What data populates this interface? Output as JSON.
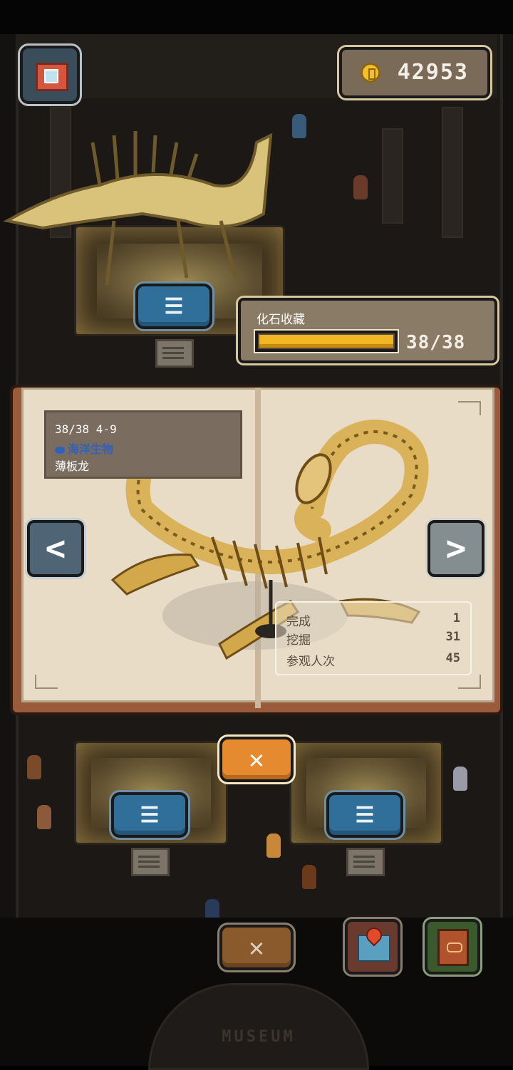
{
  "hud": {
    "coins": "42953",
    "coin_icon": "gold-coin-icon",
    "camera_icon": "camera-icon"
  },
  "collection": {
    "title": "化石收藏",
    "count": "38/38",
    "progress": 1.0
  },
  "fossil": {
    "entry": "38/38 4-9",
    "category": "海洋生物",
    "category_color": "#2f62b8",
    "name": "薄板龙",
    "stats": [
      {
        "label": "完成",
        "value": "1"
      },
      {
        "label": "挖掘",
        "value": "31"
      },
      {
        "label": "参观人次",
        "value": "45"
      }
    ]
  },
  "buttons": {
    "prev_symbol": "<",
    "next_symbol": ">",
    "close_symbol": "✕",
    "list_symbol": "☰"
  },
  "scene": {
    "entrance_sign": "MUSEUM"
  },
  "colors": {
    "book_cover": "#9a5a3c",
    "page": "#e8dcc6",
    "gold_bar": "#f2b524",
    "close_orange": "#e58a2e",
    "list_blue": "#2f6f9a"
  }
}
